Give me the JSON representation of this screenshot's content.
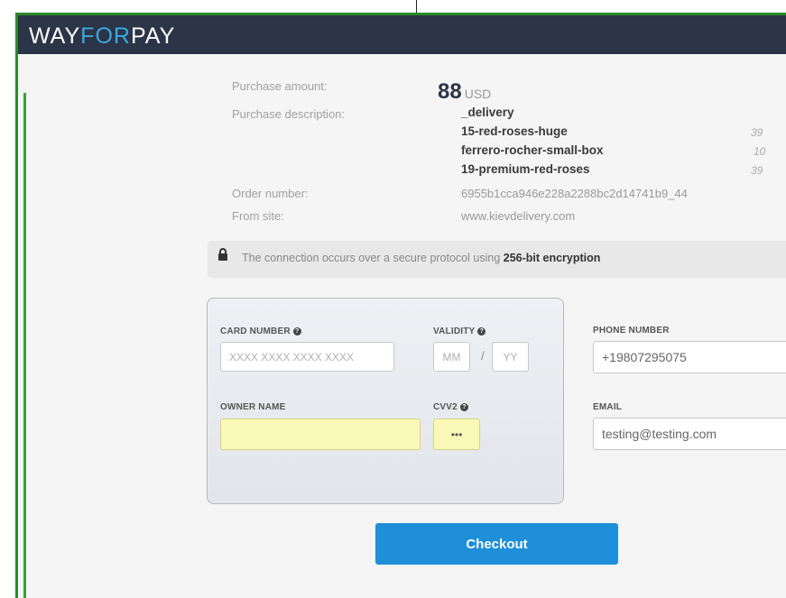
{
  "brand": {
    "logo_part1": "WAY",
    "logo_accent": "FOR",
    "logo_part2": "PAY"
  },
  "colors": {
    "header_bg": "#2b3547",
    "accent": "#39a9e0",
    "checkout_bg": "#1e8fd8",
    "frame_border": "#2a8a2a",
    "autofill_yellow": "#f9f8b6"
  },
  "summary": {
    "amount_label": "Purchase amount:",
    "amount_value": "88",
    "amount_currency": "USD",
    "description_label": "Purchase description:",
    "description_title": "_delivery",
    "items": [
      {
        "name": "15-red-roses-huge",
        "qty": "39"
      },
      {
        "name": "ferrero-rocher-small-box",
        "qty": "10"
      },
      {
        "name": "19-premium-red-roses",
        "qty": "39"
      }
    ],
    "order_label": "Order number:",
    "order_value": "6955b1cca946e228a2288bc2d14741b9_44",
    "site_label": "From site:",
    "site_value": "www.kievdelivery.com"
  },
  "security": {
    "icon": "lock-icon",
    "text_prefix": "The connection occurs over a secure protocol using ",
    "text_bold": "256-bit encryption"
  },
  "card_form": {
    "card_number_label": "CARD NUMBER",
    "card_number_placeholder": "XXXX XXXX XXXX XXXX",
    "validity_label": "VALIDITY",
    "month_placeholder": "MM",
    "year_placeholder": "YY",
    "separator": "/",
    "owner_label": "OWNER NAME",
    "owner_value": "",
    "cvv_label": "CVV2",
    "cvv_value": "•••",
    "help_glyph": "?"
  },
  "contact": {
    "phone_label": "PHONE NUMBER",
    "phone_value": "+19807295075",
    "email_label": "EMAIL",
    "email_value": "testing@testing.com"
  },
  "actions": {
    "checkout_label": "Checkout"
  }
}
